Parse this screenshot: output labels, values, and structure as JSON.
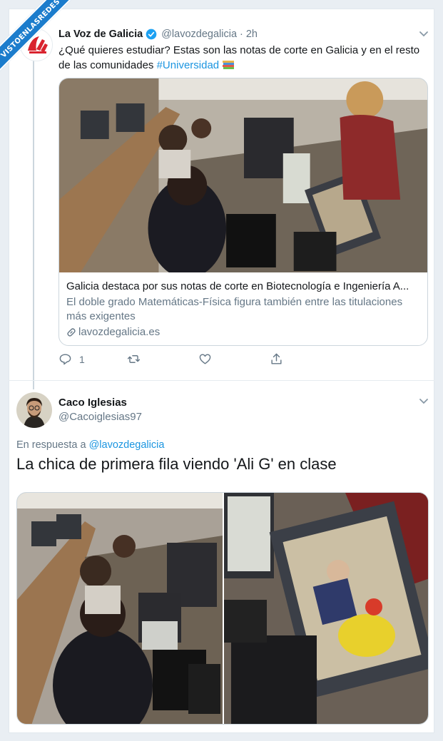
{
  "watermark": {
    "text": "VISTOENLASREDES"
  },
  "tweet1": {
    "name": "La Voz de Galicia",
    "handle": "@lavozdegalicia",
    "time": "· 2h",
    "text_main": "¿Qué quieres estudiar? Estas son las notas de corte en Galicia y en el resto de las comunidades ",
    "hashtag": "#Universidad",
    "card": {
      "title": "Galicia destaca por sus notas de corte en Biotecnología e Ingeniería A...",
      "description": "El doble grado Matemáticas-Física figura también entre las titulaciones más exigentes",
      "domain": "lavozdegalicia.es"
    },
    "actions": {
      "replies": "1",
      "retweets": "",
      "likes": ""
    }
  },
  "tweet2": {
    "name": "Caco Iglesias",
    "handle": "@Cacoiglesias97",
    "reply_prefix": "En respuesta a ",
    "reply_handle": "@lavozdegalicia",
    "text": "La chica de primera fila viendo 'Ali G' en clase"
  },
  "colors": {
    "accent": "#1b95e0",
    "secondary_text": "#657786",
    "border": "#ccd6dd"
  },
  "icons": [
    "verified-icon",
    "chevron-down-icon",
    "link-icon",
    "reply-icon",
    "retweet-icon",
    "like-icon",
    "share-icon",
    "books-emoji"
  ]
}
